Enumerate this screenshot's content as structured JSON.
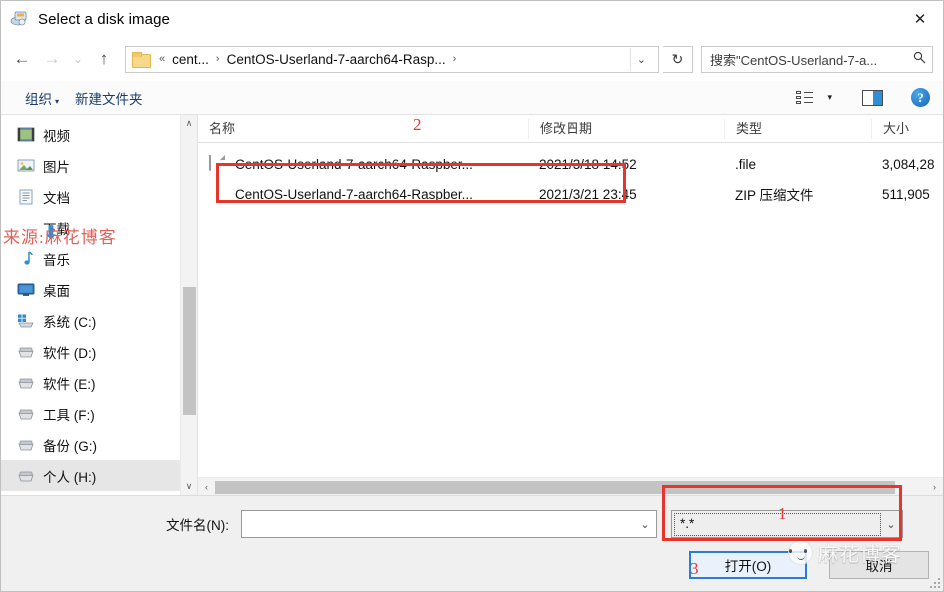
{
  "window": {
    "title": "Select a disk image",
    "icon": "disk-image-icon",
    "close_label": "✕"
  },
  "nav": {
    "back": "←",
    "forward": "→",
    "recent": "⌄",
    "up": "↑",
    "refresh": "↻",
    "breadcrumb": {
      "overflow": "«",
      "items": [
        "cent...",
        "CentOS-Userland-7-aarch64-Rasp..."
      ],
      "separator": "›",
      "dropdown": "⌄"
    },
    "search": {
      "value": "搜索\"CentOS-Userland-7-a...",
      "icon": "search-icon"
    }
  },
  "toolbar": {
    "organize_label": "组织",
    "organize_caret": "▾",
    "new_folder_label": "新建文件夹",
    "view_caret": "▾",
    "help_label": "?"
  },
  "sidebar": {
    "items": [
      {
        "label": "视频",
        "icon": "videos-icon",
        "selected": false
      },
      {
        "label": "图片",
        "icon": "pictures-icon",
        "selected": false
      },
      {
        "label": "文档",
        "icon": "documents-icon",
        "selected": false
      },
      {
        "label": "下载",
        "icon": "downloads-icon",
        "selected": false
      },
      {
        "label": "音乐",
        "icon": "music-icon",
        "selected": false
      },
      {
        "label": "桌面",
        "icon": "desktop-icon",
        "selected": false
      },
      {
        "label": "系统 (C:)",
        "icon": "windows-drive-icon",
        "selected": false
      },
      {
        "label": "软件 (D:)",
        "icon": "drive-icon",
        "selected": false
      },
      {
        "label": "软件 (E:)",
        "icon": "drive-icon",
        "selected": false
      },
      {
        "label": "工具 (F:)",
        "icon": "drive-icon",
        "selected": false
      },
      {
        "label": "备份 (G:)",
        "icon": "drive-icon",
        "selected": false
      },
      {
        "label": "个人 (H:)",
        "icon": "drive-icon",
        "selected": true
      }
    ],
    "scroll_up": "∧",
    "scroll_down": "∨"
  },
  "filelist": {
    "columns": [
      {
        "label": "名称"
      },
      {
        "label": "修改日期"
      },
      {
        "label": "类型"
      },
      {
        "label": "大小"
      }
    ],
    "sort_indicator": "∧",
    "rows": [
      {
        "name": "CentOS-Userland-7-aarch64-Raspber...",
        "date": "2021/3/18 14:52",
        "type": ".file",
        "size": "3,084,28",
        "icon": "generic-file-icon"
      },
      {
        "name": "CentOS-Userland-7-aarch64-Raspber...",
        "date": "2021/3/21 23:45",
        "type": "ZIP 压缩文件",
        "size": "511,905",
        "icon": "zip-file-icon"
      }
    ],
    "hscroll_left": "‹",
    "hscroll_right": "›"
  },
  "bottom": {
    "filename_label": "文件名(N):",
    "filename_value": "",
    "filetype_value": "*.*",
    "combo_arrow": "⌄",
    "open_button": "打开(O)",
    "cancel_button": "取消"
  },
  "annotations": {
    "markers": [
      {
        "id": "1",
        "target": "filetype-combo"
      },
      {
        "id": "2",
        "target": "selected-file-row"
      },
      {
        "id": "3",
        "target": "open-button"
      }
    ]
  },
  "watermarks": {
    "source_text": "来源:麻花博客",
    "blog_text": "麻花博客"
  },
  "colors": {
    "annotation_red": "#e8352c",
    "accent_blue": "#2a7cd4",
    "selection_gray": "#e6e6e6"
  }
}
